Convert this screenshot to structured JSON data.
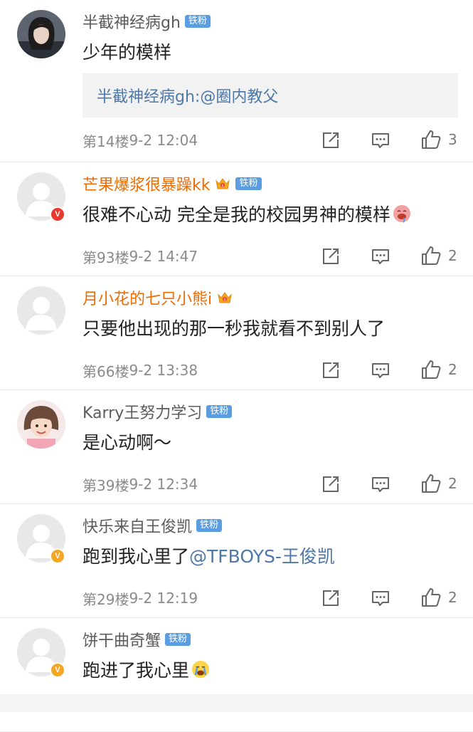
{
  "comments": [
    {
      "username": "半截神经病gh",
      "name_color": "gray",
      "avatar": "photo-girl",
      "crown": false,
      "fan_badge": "铁粉",
      "verify": "",
      "text": "少年的模样",
      "mention": "",
      "emoji": "",
      "reply": {
        "prefix": "半截神经病gh:",
        "mention": "@圈内教父"
      },
      "floor": "第14楼",
      "time": "9-2 12:04",
      "likes": "3"
    },
    {
      "username": "芒果爆浆很暴躁kk",
      "name_color": "orange",
      "avatar": "default",
      "crown": true,
      "fan_badge": "铁粉",
      "verify": "V",
      "verify_color": "red",
      "text": "很难不心动  完全是我的校园男神的模样",
      "mention": "",
      "emoji": "drooling-face-icon",
      "floor": "第93楼",
      "time": "9-2 14:47",
      "likes": "2"
    },
    {
      "username": "月小花的七只小熊i",
      "name_color": "orange",
      "avatar": "default",
      "crown": true,
      "fan_badge": "",
      "verify": "",
      "text": "只要他出现的那一秒我就看不到别人了",
      "mention": "",
      "emoji": "",
      "floor": "第66楼",
      "time": "9-2 13:38",
      "likes": "2"
    },
    {
      "username": "Karry王努力学习",
      "name_color": "gray",
      "avatar": "photo-child",
      "crown": false,
      "fan_badge": "铁粉",
      "verify": "",
      "text": "是心动啊～",
      "mention": "",
      "emoji": "",
      "floor": "第39楼",
      "time": "9-2 12:34",
      "likes": "2"
    },
    {
      "username": "快乐来自王俊凯",
      "name_color": "gray",
      "avatar": "default",
      "crown": false,
      "fan_badge": "铁粉",
      "verify": "V",
      "verify_color": "gold",
      "text": "跑到我心里了",
      "mention": "@TFBOYS-王俊凯",
      "emoji": "",
      "floor": "第29楼",
      "time": "9-2 12:19",
      "likes": "2"
    },
    {
      "username": "饼干曲奇蟹",
      "name_color": "gray",
      "avatar": "default",
      "crown": false,
      "fan_badge": "铁粉",
      "verify": "V",
      "verify_color": "gold",
      "text": "跑进了我心里",
      "mention": "",
      "emoji": "crying-face-icon",
      "floor": "",
      "time": "",
      "likes": ""
    }
  ],
  "icons": {
    "share": "share-icon",
    "reply": "comment-icon",
    "like": "thumbs-up-icon",
    "crown": "crown-icon"
  },
  "colors": {
    "fan_badge": "#5a9de0",
    "mention": "#4d78a8",
    "vip_name": "#f06b00"
  }
}
